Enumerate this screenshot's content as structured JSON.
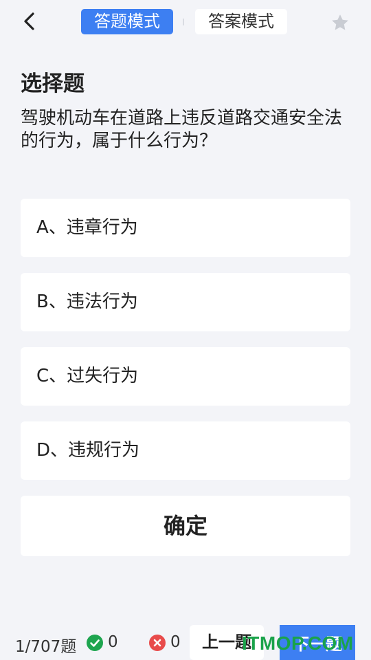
{
  "header": {
    "tab_answer_mode": "答题模式",
    "tab_solution_mode": "答案模式",
    "back_icon": "chevron-left-icon",
    "favorite_icon": "star-icon"
  },
  "question": {
    "type": "选择题",
    "text": "驾驶机动车在道路上违反道路交通安全法的行为，属于什么行为？",
    "options": [
      {
        "label": "A、违章行为"
      },
      {
        "label": "B、违法行为"
      },
      {
        "label": "C、过失行为"
      },
      {
        "label": "D、违规行为"
      }
    ],
    "confirm_label": "确定"
  },
  "footer": {
    "progress": "1/707题",
    "correct_count": "0",
    "wrong_count": "0",
    "prev_label": "上一题",
    "next_label": "下一题",
    "watermark": "ITMOP.COM"
  },
  "colors": {
    "accent": "#3d7ff2",
    "background": "#f3f4f8",
    "correct": "#1ea54f",
    "wrong": "#e84b4b"
  }
}
